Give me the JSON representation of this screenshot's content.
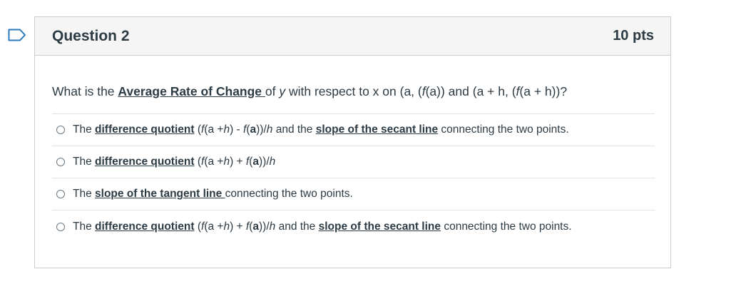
{
  "question": {
    "title": "Question 2",
    "points": "10 pts",
    "prompt": {
      "lead": "What is the ",
      "term": "Average Rate of Change ",
      "rest1": "of ",
      "y": "y",
      "rest2": " with respect to x on (a, (",
      "fa": "f",
      "rest3": "(a)) and (a + h, (",
      "fah": "f",
      "rest4": "(a + h))?"
    }
  },
  "answers": [
    {
      "the": "The ",
      "term1": "difference quotient",
      "formula_a": " (",
      "f1": "f",
      "formula_b": "(a +",
      "h1": "h",
      "formula_c": ") - ",
      "f2": "f",
      "formula_d": "(",
      "a": "a",
      "formula_e": "))/",
      "h2": "h",
      "and": " and the ",
      "term2": "slope of the secant line",
      "tail": " connecting the two points."
    },
    {
      "the": "The ",
      "term1": "difference quotient",
      "formula_a": " (",
      "f1": "f",
      "formula_b": "(a +",
      "h1": "h",
      "formula_c": ") + ",
      "f2": "f",
      "formula_d": "(",
      "a": "a",
      "formula_e": "))/",
      "h2": "h"
    },
    {
      "the": "The ",
      "term1": "slope of the tangent line ",
      "tail": "connecting the two points."
    },
    {
      "the": "The ",
      "term1": "difference quotient",
      "formula_a": " (",
      "f1": "f",
      "formula_b": "(a +",
      "h1": "h",
      "formula_c": ") + ",
      "f2": "f",
      "formula_d": "(",
      "a": "a",
      "formula_e": "))/",
      "h2": "h",
      "and": " and the ",
      "term2": "slope of the secant line",
      "tail": " connecting the two points."
    }
  ],
  "icons": {
    "flag": "flag-outline-icon",
    "radio": "radio-unchecked-icon"
  },
  "colors": {
    "flag": "#2b7abc",
    "text": "#2d3b45",
    "header_bg": "#f5f5f5",
    "border": "#c7cdd1"
  }
}
